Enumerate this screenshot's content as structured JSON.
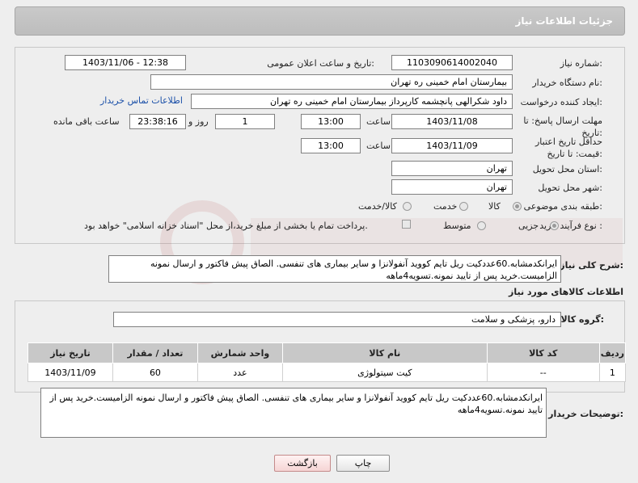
{
  "title": "جزئیات اطلاعات نیاز",
  "need_number": {
    "label": "شماره نیاز:",
    "value": "1103090614002040"
  },
  "announce": {
    "label": "تاریخ و ساعت اعلان عمومی:",
    "value": "1403/11/06 - 12:38"
  },
  "buyer_org": {
    "label": "نام دستگاه خریدار:",
    "value": "بیمارستان امام خمینی ره  تهران"
  },
  "requester": {
    "label": "ایجاد کننده درخواست:",
    "value": "داود شکرالهی پانچشمه کارپرداز بیمارستان امام خمینی ره  تهران",
    "contact_link": "اطلاعات تماس خریدار"
  },
  "reply_deadline": {
    "label": "مهلت ارسال پاسخ: تا تاریخ:",
    "date": "1403/11/08",
    "time_label": "ساعت",
    "time": "13:00",
    "days": "1",
    "days_label": "روز و",
    "remaining": "23:38:16",
    "remaining_label": "ساعت باقی مانده"
  },
  "price_validity": {
    "label": "حداقل تاریخ اعتبار قیمت: تا تاریخ:",
    "date": "1403/11/09",
    "time_label": "ساعت",
    "time": "13:00"
  },
  "province": {
    "label": "استان محل تحویل:",
    "value": "تهران"
  },
  "city": {
    "label": "شهر محل تحویل:",
    "value": "تهران"
  },
  "category": {
    "label": "طبقه بندی موضوعی:",
    "options": [
      "کالا",
      "خدمت",
      "کالا/خدمت"
    ]
  },
  "process": {
    "label": "نوع فرآیند خرید :",
    "options": [
      "جزیی",
      "متوسط"
    ],
    "note": "پرداخت تمام یا بخشی از مبلغ خرید،از محل \"اسناد خزانه اسلامی\" خواهد بود."
  },
  "description": {
    "label": "شرح کلی نیاز:",
    "value": "ایرانکدمشابه.60عددکیت ریل تایم کووید آنفولانزا و سایر بیماری های تنفسی. الصاق پیش فاکتور و ارسال نمونه الزامیست.خرید پس از تایید نمونه.تسویه4ماهه"
  },
  "goods_info_title": "اطلاعات کالاهای مورد نیاز",
  "goods_group": {
    "label": "گروه کالا:",
    "value": "دارو، پزشکی و سلامت"
  },
  "table": {
    "headers": [
      "ردیف",
      "کد کالا",
      "نام کالا",
      "واحد شمارش",
      "تعداد / مقدار",
      "تاریخ نیاز"
    ],
    "rows": [
      [
        "1",
        "--",
        "کیت سیتولوژی",
        "عدد",
        "60",
        "1403/11/09"
      ]
    ]
  },
  "buyer_notes": {
    "label": "توضیحات خریدار:",
    "value": "ایرانکدمشابه.60عددکیت ریل تایم کووید آنفولانزا و سایر بیماری های تنفسی. الصاق پیش فاکتور و ارسال نمونه الزامیست.خرید پس از تایید نمونه.تسویه4ماهه"
  },
  "buttons": {
    "print": "چاپ",
    "back": "بازگشت"
  },
  "colors": {
    "header_gray": "#c8c8c8",
    "link_blue": "#1a4fa8",
    "back_button_pink": "#f6d5d5"
  }
}
